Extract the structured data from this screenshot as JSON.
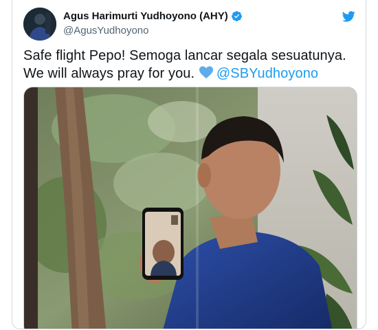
{
  "author": {
    "display_name": "Agus Harimurti Yudhoyono (AHY)",
    "handle": "@AgusYudhoyono",
    "verified": true,
    "avatar_icon": "profile-photo"
  },
  "tweet": {
    "text_before": "Safe flight Pepo! Semoga lancar segala sesuatunya. We will always pray for you.",
    "emoji": "blue-heart",
    "mention": "@SBYudhoyono"
  },
  "brand": {
    "icon": "twitter-bird-icon",
    "color": "#1d9bf0"
  },
  "media": {
    "description_icon": "photo"
  }
}
